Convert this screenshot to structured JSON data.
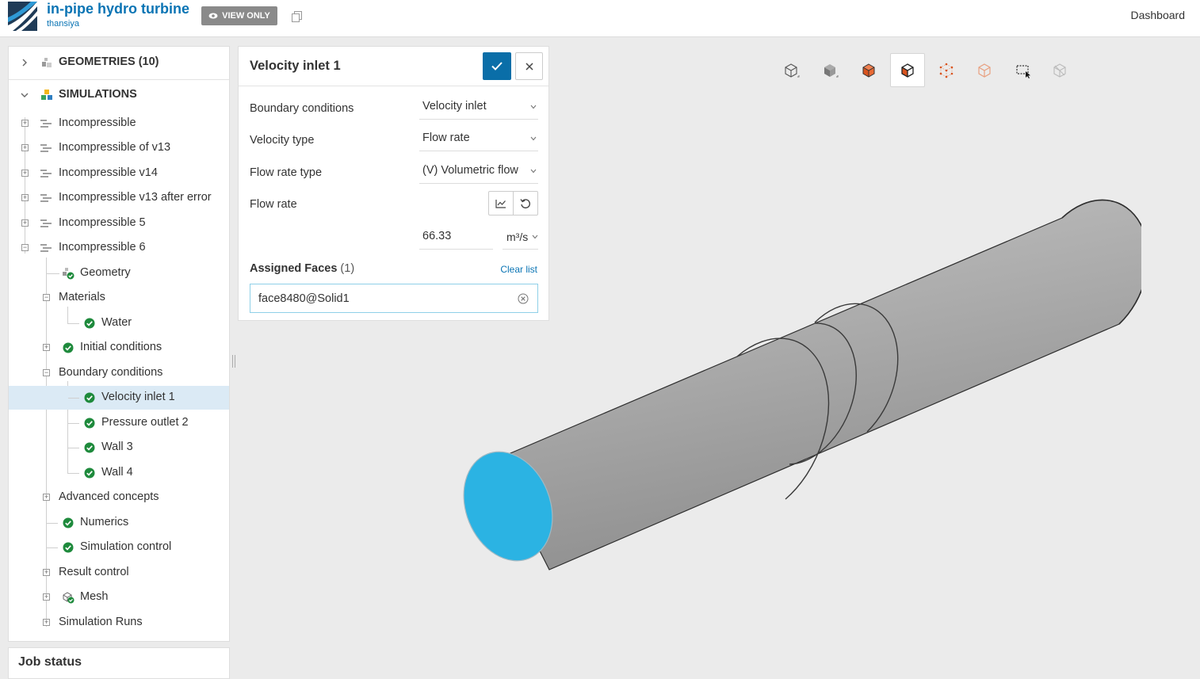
{
  "header": {
    "project_title": "in-pipe hydro turbine",
    "project_user": "thansiya",
    "view_only_label": "VIEW ONLY",
    "dashboard_link": "Dashboard"
  },
  "tree": {
    "geometries_label": "GEOMETRIES (10)",
    "simulations_label": "SIMULATIONS",
    "items": [
      {
        "label": "Incompressible"
      },
      {
        "label": "Incompressible of v13"
      },
      {
        "label": "Incompressible v14"
      },
      {
        "label": "Incompressible v13 after error"
      },
      {
        "label": "Incompressible 5"
      },
      {
        "label": "Incompressible 6"
      },
      {
        "label": "Geometry"
      },
      {
        "label": "Materials"
      },
      {
        "label": "Water"
      },
      {
        "label": "Initial conditions"
      },
      {
        "label": "Boundary conditions"
      },
      {
        "label": "Velocity inlet 1"
      },
      {
        "label": "Pressure outlet 2"
      },
      {
        "label": "Wall 3"
      },
      {
        "label": "Wall 4"
      },
      {
        "label": "Advanced concepts"
      },
      {
        "label": "Numerics"
      },
      {
        "label": "Simulation control"
      },
      {
        "label": "Result control"
      },
      {
        "label": "Mesh"
      },
      {
        "label": "Simulation Runs"
      }
    ]
  },
  "job_status": {
    "title": "Job status"
  },
  "panel": {
    "title": "Velocity inlet 1",
    "fields": {
      "boundary_conditions": {
        "label": "Boundary conditions",
        "value": "Velocity inlet"
      },
      "velocity_type": {
        "label": "Velocity type",
        "value": "Flow rate"
      },
      "flow_rate_type": {
        "label": "Flow rate type",
        "value": "(V) Volumetric flow"
      },
      "flow_rate": {
        "label": "Flow rate",
        "value": "66.33",
        "unit": "m³/s"
      }
    },
    "assigned_faces": {
      "label": "Assigned Faces",
      "count": "(1)",
      "clear_label": "Clear list",
      "faces": [
        "face8480@Solid1"
      ]
    }
  },
  "colors": {
    "accent": "#0a74b4",
    "selected_face": "#2bb3e3",
    "status_green": "#1e8a3c",
    "pipe_gray": "#a7a7a7"
  }
}
